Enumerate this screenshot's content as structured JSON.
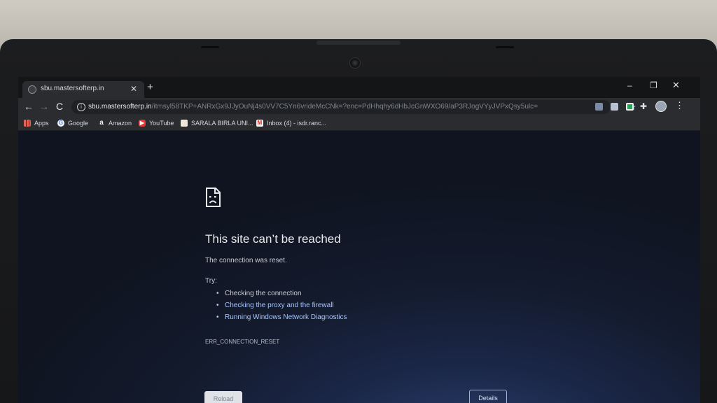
{
  "browser": {
    "tab": {
      "title": "sbu.mastersofterp.in",
      "close_glyph": "✕"
    },
    "new_tab_glyph": "+",
    "window_controls": {
      "minimize": "–",
      "maximize": "❐",
      "close": "✕"
    },
    "toolbar": {
      "back_glyph": "←",
      "forward_glyph": "→",
      "reload_glyph": "C",
      "info_glyph": "i",
      "url_host": "sbu.mastersofterp.in",
      "url_path": "/itmsyl58TKP+ANRxGx9JJyOuNj4s0VV7C5Yn6vrideMcCNk=?enc=PdHhqhy6dHbJcGnWXO69/aP3RJogVYyJVPxQsy5ulc=",
      "star_glyph": "★",
      "extensions_glyph": "✚",
      "menu_glyph": "⋮"
    },
    "bookmarks": [
      {
        "label": "Apps",
        "icon": "apps-grid-icon",
        "glyph": ""
      },
      {
        "label": "Google",
        "icon": "google-icon",
        "glyph": "G"
      },
      {
        "label": "Amazon",
        "icon": "amazon-icon",
        "glyph": "a"
      },
      {
        "label": "YouTube",
        "icon": "youtube-icon",
        "glyph": "▶"
      },
      {
        "label": "SARALA BIRLA UNI...",
        "icon": "sarala-birla-icon",
        "glyph": ""
      },
      {
        "label": "Inbox (4) - isdr.ranc...",
        "icon": "gmail-icon",
        "glyph": "M"
      }
    ]
  },
  "error_page": {
    "title": "This site can’t be reached",
    "description": "The connection was reset.",
    "try_label": "Try:",
    "suggestions": [
      "Checking the connection",
      "Checking the proxy and the firewall",
      "Running Windows Network Diagnostics"
    ],
    "error_code": "ERR_CONNECTION_RESET",
    "reload_label": "Reload",
    "details_label": "Details"
  },
  "colors": {
    "accent_link": "#a9c6ff",
    "page_background": "#131a2c",
    "star": "#8ab4f8"
  }
}
